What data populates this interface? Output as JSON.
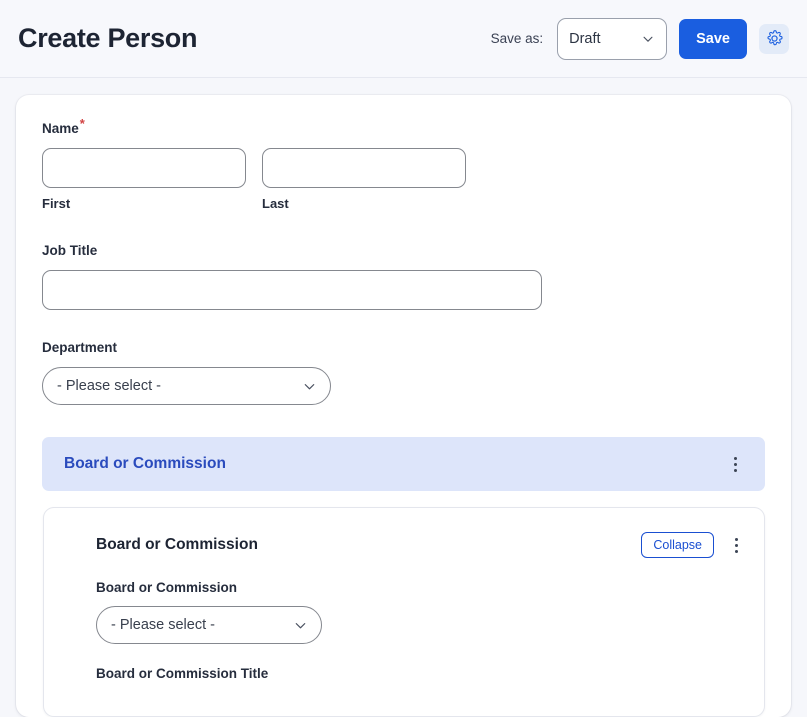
{
  "header": {
    "title": "Create Person",
    "save_as_label": "Save as:",
    "status_value": "Draft",
    "save_label": "Save",
    "gear_icon": "gear-icon",
    "chevron_icon": "chevron-down-icon"
  },
  "form": {
    "name": {
      "label": "Name",
      "required_marker": "*",
      "first": {
        "sub_label": "First",
        "value": "",
        "placeholder": ""
      },
      "last": {
        "sub_label": "Last",
        "value": "",
        "placeholder": ""
      }
    },
    "job_title": {
      "label": "Job Title",
      "value": "",
      "placeholder": ""
    },
    "department": {
      "label": "Department",
      "selected": "- Please select -"
    }
  },
  "section": {
    "title": "Board or Commission",
    "menu_icon": "kebab-menu-icon"
  },
  "repeat_card": {
    "title": "Board or Commission",
    "collapse_label": "Collapse",
    "menu_icon": "kebab-menu-icon",
    "board_select": {
      "label": "Board or Commission",
      "selected": "- Please select -"
    },
    "board_title": {
      "label": "Board or Commission Title"
    }
  },
  "colors": {
    "accent_blue": "#1a5ee0",
    "section_bar_bg": "#dde5fa",
    "section_bar_text": "#2a4bbd",
    "required_red": "#d14343",
    "page_bg": "#f6f7fb",
    "border_gray": "#85888f"
  }
}
